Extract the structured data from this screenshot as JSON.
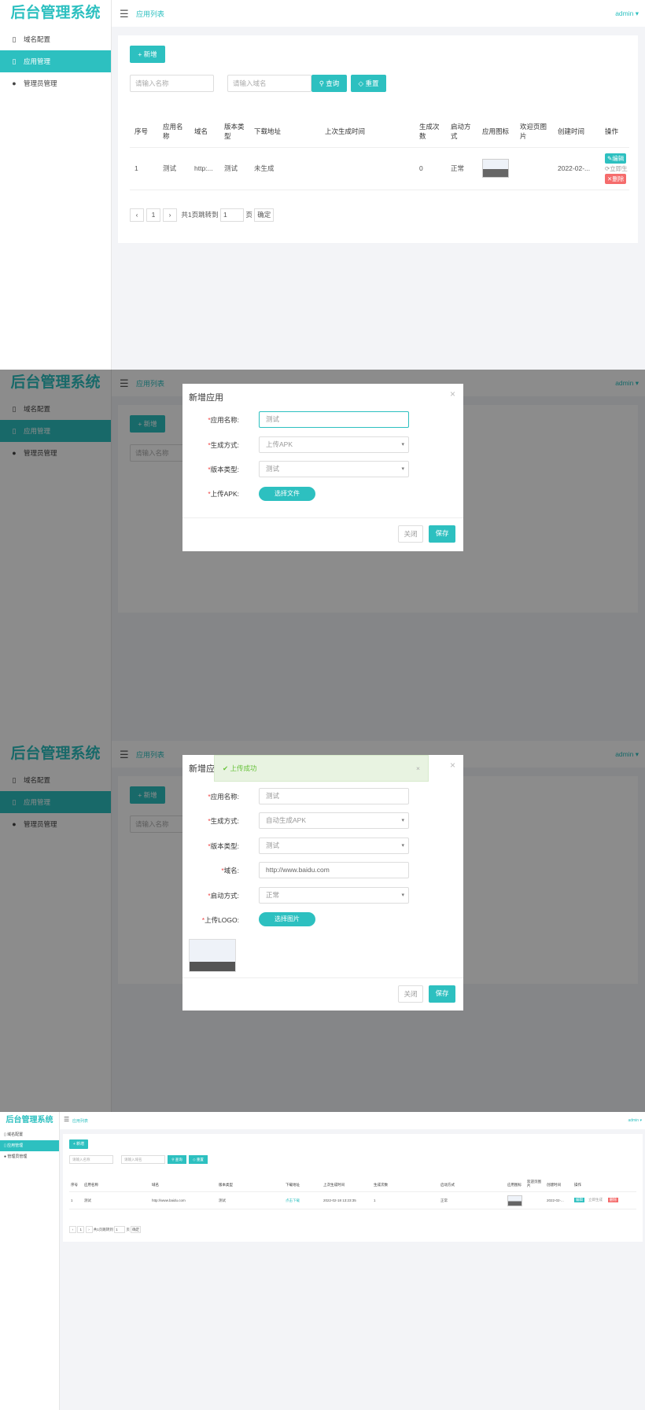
{
  "app": {
    "title": "后台管理系统",
    "breadcrumb": "应用列表",
    "user": "admin"
  },
  "sidebar": {
    "items": [
      {
        "label": "域名配置",
        "icon": "clipboard-icon"
      },
      {
        "label": "应用管理",
        "icon": "clipboard-icon",
        "active": true
      },
      {
        "label": "管理员管理",
        "icon": "user-icon"
      }
    ]
  },
  "toolbar": {
    "add_label": "+ 新增",
    "name_placeholder": "请输入名称",
    "domain_placeholder": "请输入域名",
    "query_label": "查询",
    "reset_label": "重置"
  },
  "table": {
    "columns": [
      "序号",
      "应用名称",
      "域名",
      "版本类型",
      "下载地址",
      "上次生成时间",
      "生成次数",
      "启动方式",
      "应用图标",
      "欢迎页图片",
      "创建时间",
      "操作"
    ],
    "rows_panel1": [
      {
        "index": "1",
        "name": "测试",
        "domain": "http:...",
        "version": "测试",
        "download": "未生成",
        "last_time": "",
        "count": "0",
        "launch": "正常",
        "created": "2022-02-..."
      }
    ],
    "rows_panel4": [
      {
        "index": "1",
        "name": "测试",
        "domain": "http://www.baidu.com",
        "version": "测试",
        "download": "点击下载",
        "last_time": "2022-02-18 13:23:35",
        "count": "1",
        "launch": "正常",
        "created": "2022-02-..."
      }
    ],
    "actions": {
      "edit": "编辑",
      "generate": "立即生",
      "delete": "删除",
      "generate_full": "立即生成"
    }
  },
  "pager": {
    "prev": "‹",
    "page": "1",
    "next": "›",
    "total_text": "共1页跳转到",
    "goto_value": "1",
    "page_unit": "页",
    "confirm": "确定"
  },
  "dialog1": {
    "title": "新增应用",
    "fields": [
      {
        "label": "应用名称:",
        "value": "测试"
      },
      {
        "label": "生成方式:",
        "value": "上传APK"
      },
      {
        "label": "版本类型:",
        "value": "测试"
      },
      {
        "label": "上传APK:",
        "value": "选择文件"
      }
    ],
    "close_label": "关闭",
    "save_label": "保存"
  },
  "dialog2": {
    "title": "新增应",
    "toast": "上传成功",
    "fields": [
      {
        "label": "应用名称:",
        "value": "测试"
      },
      {
        "label": "生成方式:",
        "value": "自动生成APK"
      },
      {
        "label": "版本类型:",
        "value": "测试"
      },
      {
        "label": "域名:",
        "value": "http://www.baidu.com"
      },
      {
        "label": "启动方式:",
        "value": "正常"
      },
      {
        "label": "上传LOGO:",
        "value": "选择图片"
      }
    ],
    "close_label": "关闭",
    "save_label": "保存"
  },
  "colors": {
    "accent": "#2dc0c0",
    "danger": "#f56c6c"
  }
}
